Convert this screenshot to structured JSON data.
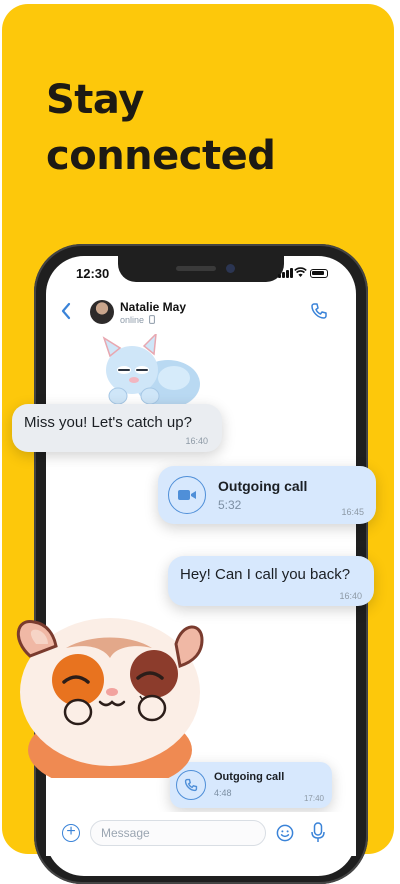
{
  "headline": {
    "line1": "Stay",
    "line2": "connected"
  },
  "status_bar": {
    "time": "12:30"
  },
  "chat_header": {
    "name": "Natalie May",
    "status": "online"
  },
  "messages": [
    {
      "text": "Miss you! Let's catch up?",
      "time": "16:40"
    },
    {
      "title": "Outgoing call",
      "duration": "5:32",
      "time": "16:45"
    },
    {
      "text": "Hey! Can I call you back?",
      "time": "16:40"
    },
    {
      "title": "Outgoing call",
      "duration": "4:48",
      "time": "17:40"
    }
  ],
  "composer": {
    "placeholder": "Message"
  },
  "colors": {
    "background": "#fdc80b",
    "accent": "#3a83d8",
    "outgoing_bubble": "#d7e8fd",
    "incoming_bubble": "#eaedf1"
  },
  "icons": [
    "back-icon",
    "phone-icon",
    "video-camera-icon",
    "phone-call-icon",
    "add-icon",
    "emoji-icon",
    "microphone-icon"
  ]
}
